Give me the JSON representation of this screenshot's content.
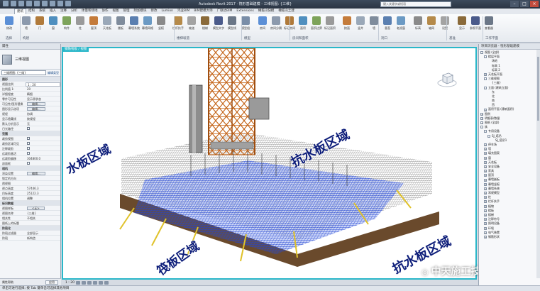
{
  "window": {
    "title": "Autodesk Revit 2017 · 筏形基础建模 - 三维视图: {三维}",
    "search_placeholder": "键入关键字或短语"
  },
  "ribbon": {
    "tabs": [
      "建筑",
      "结构",
      "系统",
      "插入",
      "注释",
      "分析",
      "体量和场地",
      "协作",
      "视图",
      "管理",
      "附加模块",
      "修改",
      "Lumion",
      "鸿业BIM",
      "BIM建模大师",
      "广联达BIM",
      "Extensions",
      "橄榄山快模",
      "橄榄山土建"
    ],
    "active_tab": "建筑",
    "tools": [
      {
        "label": "修改"
      },
      {
        "label": "墙"
      },
      {
        "label": "门"
      },
      {
        "label": "窗"
      },
      {
        "label": "构件"
      },
      {
        "label": "柱"
      },
      {
        "label": "屋顶"
      },
      {
        "label": "天花板"
      },
      {
        "label": "楼板"
      },
      {
        "label": "幕墙系统"
      },
      {
        "label": "幕墙网格"
      },
      {
        "label": "竖梃"
      },
      {
        "label": "栏杆扶手"
      },
      {
        "label": "坡道"
      },
      {
        "label": "楼梯"
      },
      {
        "label": "模型文字"
      },
      {
        "label": "模型线"
      },
      {
        "label": "模型组"
      },
      {
        "label": "房间"
      },
      {
        "label": "房间分隔"
      },
      {
        "label": "标记房间"
      },
      {
        "label": "面积"
      },
      {
        "label": "面积边界"
      },
      {
        "label": "标记面积"
      },
      {
        "label": "按面"
      },
      {
        "label": "竖井"
      },
      {
        "label": "墙"
      },
      {
        "label": "垂直"
      },
      {
        "label": "老虎窗"
      },
      {
        "label": "标高"
      },
      {
        "label": "轴网"
      },
      {
        "label": "设置"
      },
      {
        "label": "显示"
      },
      {
        "label": "参照平面"
      },
      {
        "label": "查看器"
      }
    ],
    "panels": [
      "选择",
      "构建",
      "楼梯坡道",
      "模型",
      "房间和面积",
      "洞口",
      "基准",
      "工作平面"
    ]
  },
  "properties": {
    "header": "属性",
    "type_name": "三维视图",
    "selector": "三维视图: {三维}",
    "edit_type": "编辑类型",
    "rows": [
      {
        "k": "图形",
        "v": "",
        "grp": true
      },
      {
        "k": "视图比例",
        "v": "1 : 20",
        "box": true
      },
      {
        "k": "比例值 1:",
        "v": "20"
      },
      {
        "k": "详细程度",
        "v": "精细"
      },
      {
        "k": "零件可见性",
        "v": "显示原状态"
      },
      {
        "k": "可见性/图形替换",
        "v": "编辑...",
        "btn": true
      },
      {
        "k": "图形显示选项",
        "v": "编辑...",
        "btn": true
      },
      {
        "k": "规程",
        "v": "协调"
      },
      {
        "k": "显示隐藏线",
        "v": "按规程"
      },
      {
        "k": "默认分析显示",
        "v": "无"
      },
      {
        "k": "日光路径",
        "v": "",
        "chk": false
      },
      {
        "k": "范围",
        "v": "",
        "grp": true
      },
      {
        "k": "裁剪视图",
        "v": "",
        "chk": false
      },
      {
        "k": "裁剪区域可见",
        "v": "",
        "chk": false
      },
      {
        "k": "注释裁剪",
        "v": "",
        "chk": false
      },
      {
        "k": "远裁剪激活",
        "v": "",
        "chk": false
      },
      {
        "k": "远裁剪偏移",
        "v": "304800.0"
      },
      {
        "k": "剖面框",
        "v": "",
        "chk": false
      },
      {
        "k": "相机",
        "v": "",
        "grp": true
      },
      {
        "k": "渲染设置",
        "v": "编辑...",
        "btn": true
      },
      {
        "k": "锁定的方向",
        "v": ""
      },
      {
        "k": "透视图",
        "v": ""
      },
      {
        "k": "视点高度",
        "v": "57446.3"
      },
      {
        "k": "目标高度",
        "v": "25122.3"
      },
      {
        "k": "相机位置",
        "v": "调整"
      },
      {
        "k": "标识数据",
        "v": "",
        "grp": true
      },
      {
        "k": "视图样板",
        "v": "<无>",
        "btn": true
      },
      {
        "k": "视图名称",
        "v": "{三维}"
      },
      {
        "k": "相关性",
        "v": "不相关"
      },
      {
        "k": "图纸上的标题",
        "v": ""
      },
      {
        "k": "阶段化",
        "v": "",
        "grp": true
      },
      {
        "k": "阶段过滤器",
        "v": "全部显示"
      },
      {
        "k": "阶段",
        "v": "新构造"
      }
    ],
    "help_link": "属性帮助",
    "apply": "应用"
  },
  "view": {
    "tab_label": "钢筋筏板 / 视图",
    "labels": {
      "left": "水板区域",
      "top_right": "抗水板区域",
      "bottom_center": "筏板区域",
      "bottom_right": "抗水板区域"
    },
    "watermark": "中天施工技术",
    "scale": "1 : 20"
  },
  "browser": {
    "header": "项目浏览器 - 筏形基础建模",
    "items": [
      {
        "t": "视图 (全部)",
        "d": 0,
        "tg": "-"
      },
      {
        "t": "楼层平面",
        "d": 1,
        "tg": "-"
      },
      {
        "t": "场地",
        "d": 2
      },
      {
        "t": "标高 1",
        "d": 2
      },
      {
        "t": "标高 2",
        "d": 2
      },
      {
        "t": "天花板平面",
        "d": 1,
        "tg": "+"
      },
      {
        "t": "三维视图",
        "d": 1,
        "tg": "-"
      },
      {
        "t": "{三维}",
        "d": 2
      },
      {
        "t": "立面 (建筑立面)",
        "d": 1,
        "tg": "-"
      },
      {
        "t": "东",
        "d": 2
      },
      {
        "t": "北",
        "d": 2
      },
      {
        "t": "南",
        "d": 2
      },
      {
        "t": "西",
        "d": 2
      },
      {
        "t": "面积平面 (建筑面积)",
        "d": 1,
        "tg": "+"
      },
      {
        "t": "图例",
        "d": 0,
        "tg": "+"
      },
      {
        "t": "明细表/数量",
        "d": 0,
        "tg": "+"
      },
      {
        "t": "图纸 (全部)",
        "d": 0,
        "tg": "+"
      },
      {
        "t": "族",
        "d": 0,
        "tg": "-"
      },
      {
        "t": "专用设备",
        "d": 1,
        "tg": "-"
      },
      {
        "t": "SJ_塔吊",
        "d": 2,
        "tg": "-"
      },
      {
        "t": "SJ_塔吊1",
        "d": 3
      },
      {
        "t": "停车场",
        "d": 1,
        "tg": "+"
      },
      {
        "t": "墙",
        "d": 1,
        "tg": "+"
      },
      {
        "t": "填充图案",
        "d": 1,
        "tg": "+"
      },
      {
        "t": "窗",
        "d": 1,
        "tg": "+"
      },
      {
        "t": "天花板",
        "d": 1,
        "tg": "+"
      },
      {
        "t": "安全设备",
        "d": 1,
        "tg": "+"
      },
      {
        "t": "家具",
        "d": 1,
        "tg": "+"
      },
      {
        "t": "屋顶",
        "d": 1,
        "tg": "+"
      },
      {
        "t": "幕墙嵌板",
        "d": 1,
        "tg": "+"
      },
      {
        "t": "幕墙竖梃",
        "d": 1,
        "tg": "+"
      },
      {
        "t": "幕墙系统",
        "d": 1,
        "tg": "+"
      },
      {
        "t": "常规模型",
        "d": 1,
        "tg": "+"
      },
      {
        "t": "柱",
        "d": 1,
        "tg": "+"
      },
      {
        "t": "栏杆扶手",
        "d": 1,
        "tg": "+"
      },
      {
        "t": "植物",
        "d": 1,
        "tg": "+"
      },
      {
        "t": "楼板",
        "d": 1,
        "tg": "+"
      },
      {
        "t": "楼梯",
        "d": 1,
        "tg": "+"
      },
      {
        "t": "注释符号",
        "d": 1,
        "tg": "+"
      },
      {
        "t": "照明设备",
        "d": 1,
        "tg": "+"
      },
      {
        "t": "环境",
        "d": 1,
        "tg": "+"
      },
      {
        "t": "电气装置",
        "d": 1,
        "tg": "+"
      },
      {
        "t": "钢筋形状",
        "d": 1,
        "tg": "+"
      }
    ]
  },
  "status": {
    "left": "单击可进行选择; 按 Tab 键单击可选择其他项目"
  },
  "colors": {
    "accent": "#2ab7c9",
    "rebar_blue": "#1f3fcf",
    "tower_orange": "#d4701e"
  }
}
